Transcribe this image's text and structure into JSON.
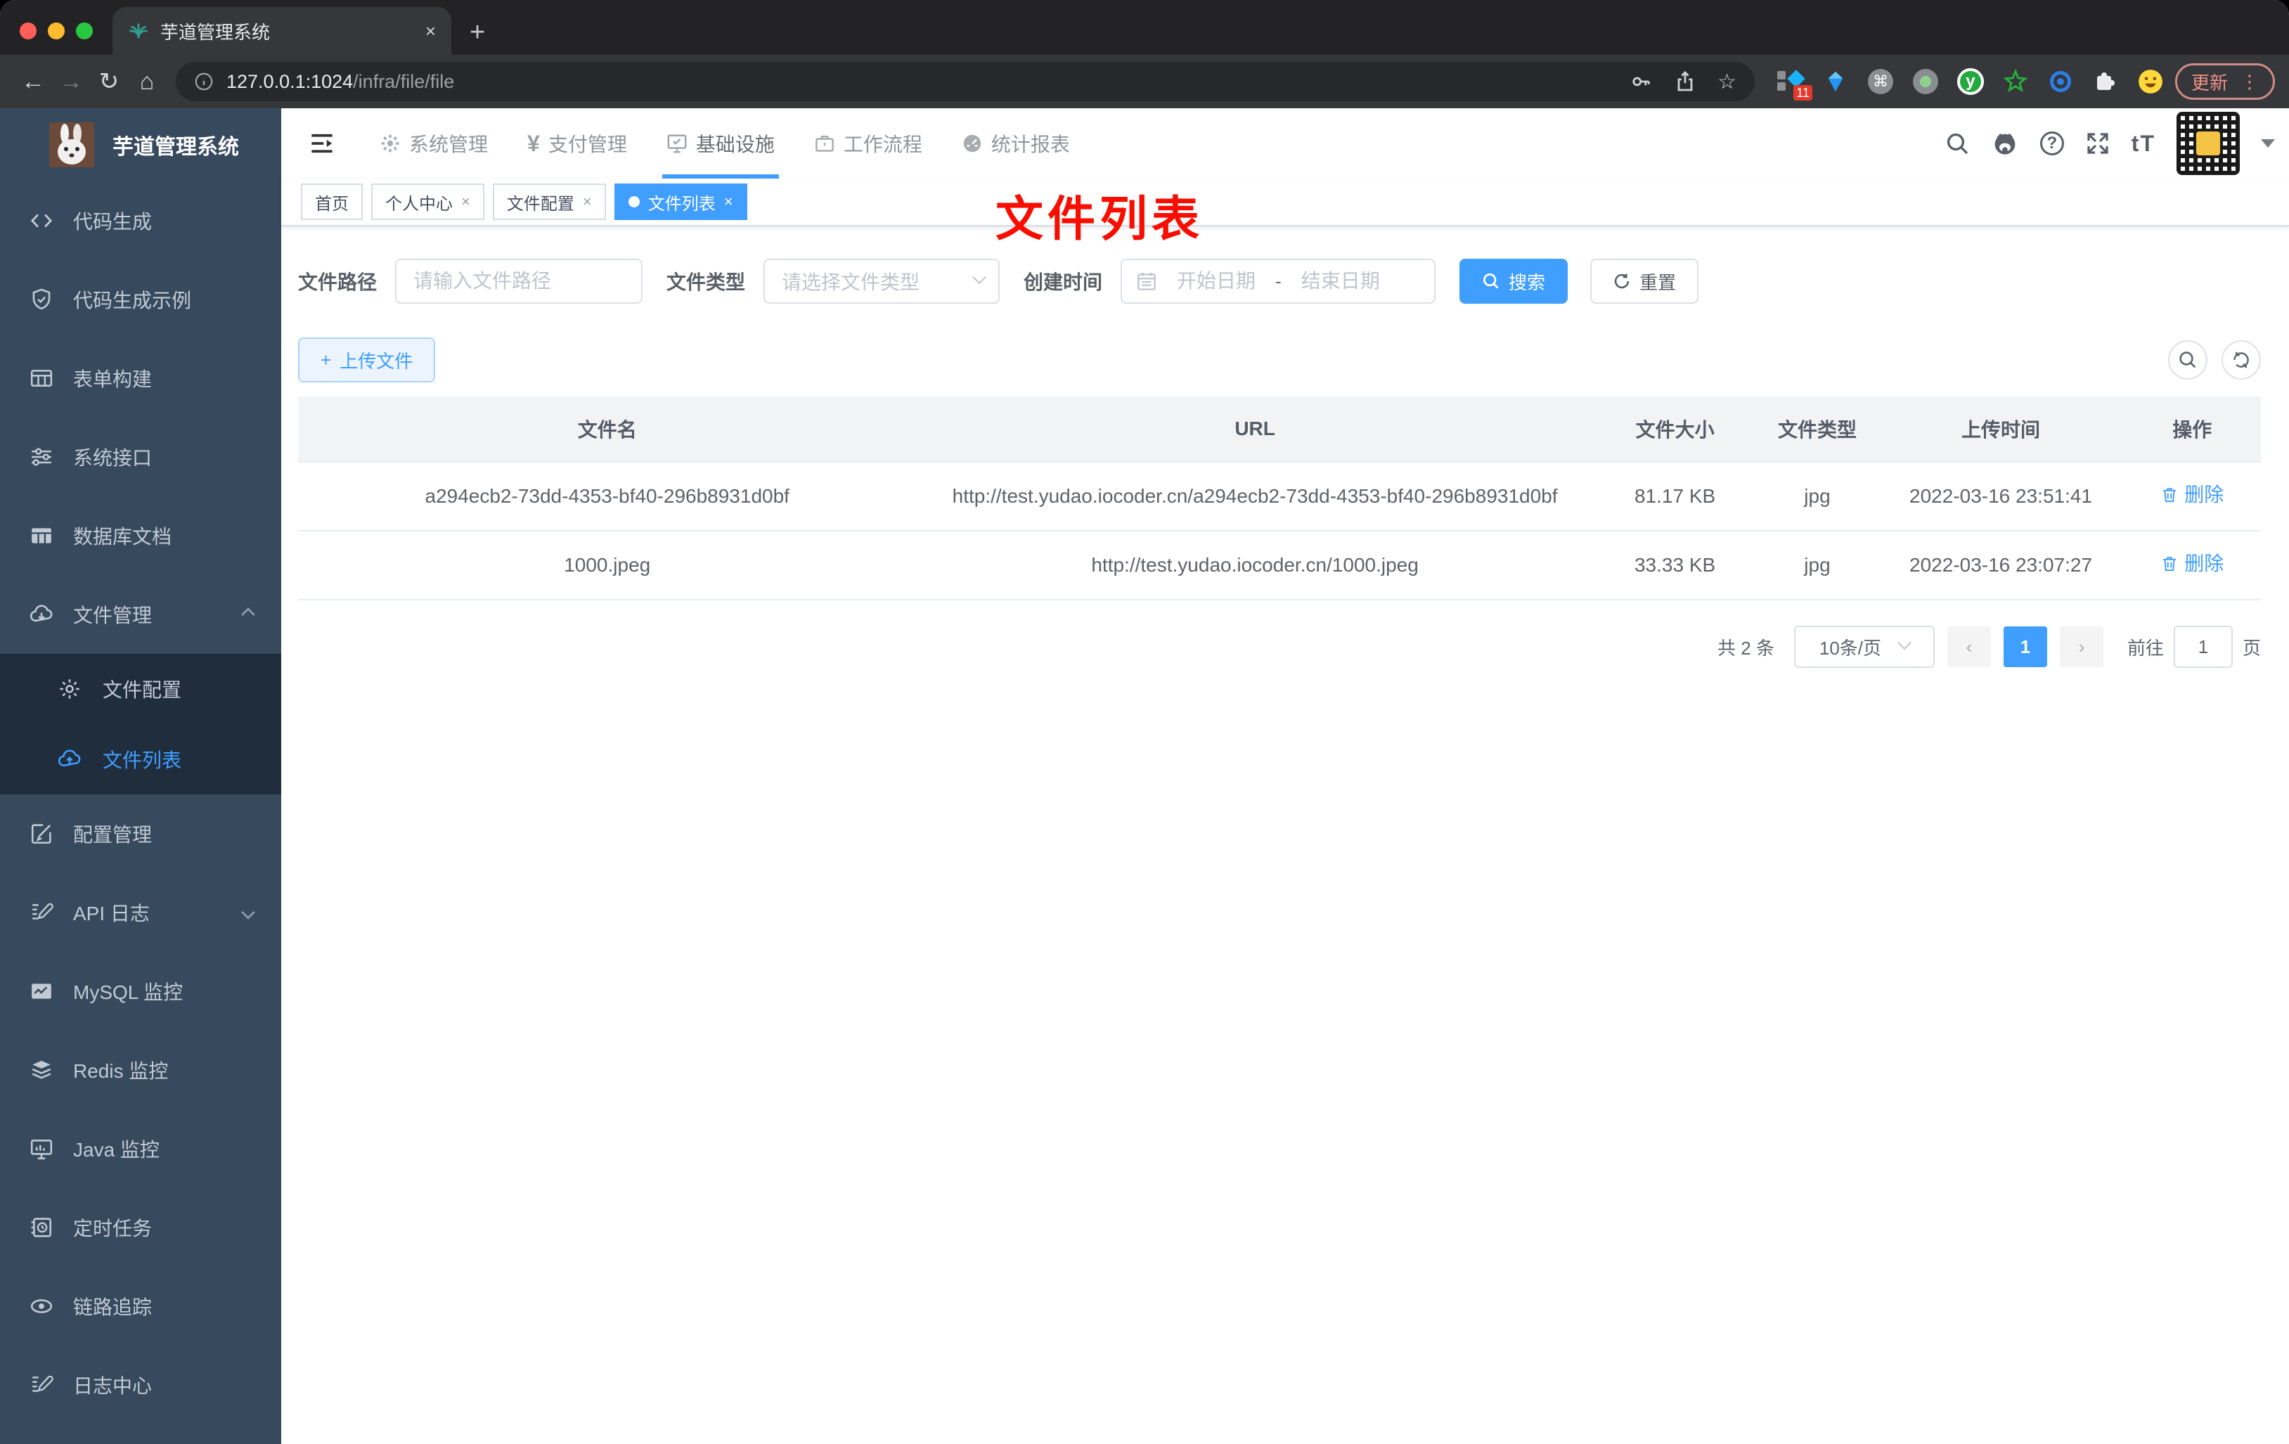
{
  "colors": {
    "accent": "#409eff",
    "sidebar_bg": "#36495d",
    "submenu_bg": "#1f2d3d",
    "annotation_red": "#f80e00",
    "chrome_strip": "#232326",
    "chrome_toolbar": "#36373a",
    "update_pink": "#ef9186",
    "traffic_red": "#ff5f57",
    "traffic_yellow": "#febc2e",
    "traffic_green": "#28c840",
    "active_tag_bg": "#409eff"
  },
  "browser": {
    "tab_title": "芋道管理系统",
    "tab_close_glyph": "×",
    "new_tab_glyph": "+",
    "back_glyph": "←",
    "forward_glyph": "→",
    "reload_glyph": "↻",
    "home_glyph": "⌂",
    "url_host": "127.0.0.1:1024",
    "url_path": "/infra/file/file",
    "bookmark_star_glyph": "☆",
    "cmd_glyph": "⌘",
    "ext_y_glyph": "y",
    "ext_badge": "11",
    "update_label": "更新",
    "menu_dots_glyph": "⋮"
  },
  "app": {
    "logo_title": "芋道管理系统",
    "nav_items": [
      {
        "label": "系统管理"
      },
      {
        "label": "支付管理",
        "glyph": "¥"
      },
      {
        "label": "基础设施"
      },
      {
        "label": "工作流程"
      },
      {
        "label": "统计报表"
      }
    ],
    "help_glyph": "?",
    "text_size_glyph": "tT"
  },
  "sidebar": {
    "items": [
      {
        "label": "代码生成"
      },
      {
        "label": "代码生成示例"
      },
      {
        "label": "表单构建"
      },
      {
        "label": "系统接口"
      },
      {
        "label": "数据库文档"
      },
      {
        "label": "文件管理"
      },
      {
        "label": "文件配置"
      },
      {
        "label": "文件列表"
      },
      {
        "label": "配置管理"
      },
      {
        "label": "API 日志"
      },
      {
        "label": "MySQL 监控"
      },
      {
        "label": "Redis 监控"
      },
      {
        "label": "Java 监控"
      },
      {
        "label": "定时任务"
      },
      {
        "label": "链路追踪"
      },
      {
        "label": "日志中心"
      }
    ]
  },
  "tags": [
    {
      "label": "首页"
    },
    {
      "label": "个人中心",
      "close": "×"
    },
    {
      "label": "文件配置",
      "close": "×"
    },
    {
      "label": "文件列表",
      "close": "×"
    }
  ],
  "annotation": "文件列表",
  "filter": {
    "path_label": "文件路径",
    "path_placeholder": "请输入文件路径",
    "type_label": "文件类型",
    "type_placeholder": "请选择文件类型",
    "date_label": "创建时间",
    "date_start_placeholder": "开始日期",
    "date_separator": "-",
    "date_end_placeholder": "结束日期",
    "search_label": "搜索",
    "reset_label": "重置"
  },
  "toolbar": {
    "upload_label": "上传文件",
    "plus_glyph": "+"
  },
  "table": {
    "columns": [
      "文件名",
      "URL",
      "文件大小",
      "文件类型",
      "上传时间",
      "操作"
    ],
    "rows": [
      {
        "name": "a294ecb2-73dd-4353-bf40-296b8931d0bf",
        "url": "http://test.yudao.iocoder.cn/a294ecb2-73dd-4353-bf40-296b8931d0bf",
        "size": "81.17 KB",
        "type": "jpg",
        "time": "2022-03-16 23:51:41",
        "action": "删除"
      },
      {
        "name": "1000.jpeg",
        "url": "http://test.yudao.iocoder.cn/1000.jpeg",
        "size": "33.33 KB",
        "type": "jpg",
        "time": "2022-03-16 23:07:27",
        "action": "删除"
      }
    ]
  },
  "pagination": {
    "total": "共 2 条",
    "page_size": "10条/页",
    "prev_glyph": "‹",
    "next_glyph": "›",
    "current_page": "1",
    "goto_label": "前往",
    "goto_value": "1",
    "page_label": "页"
  }
}
